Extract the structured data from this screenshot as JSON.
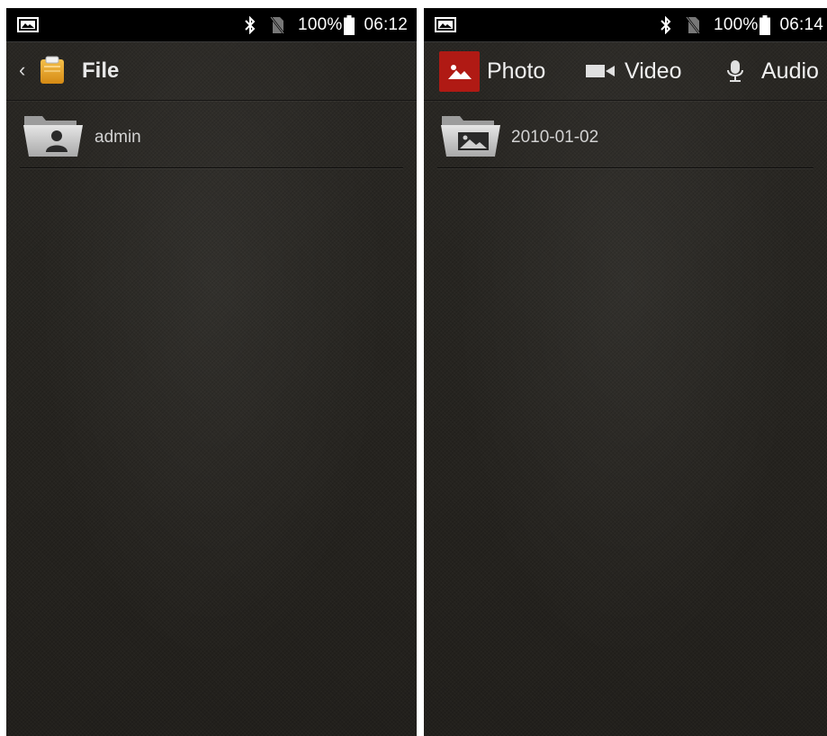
{
  "left_screen": {
    "status_bar": {
      "battery": "100%",
      "time": "06:12",
      "icons": [
        "screenshot-notification-icon",
        "bluetooth-icon",
        "no-sim-icon",
        "battery-icon"
      ]
    },
    "header": {
      "back": "‹",
      "app_icon": "file-manager-icon",
      "title": "File"
    },
    "items": [
      {
        "label": "admin",
        "icon": "user-folder-icon"
      }
    ]
  },
  "right_screen": {
    "status_bar": {
      "battery": "100%",
      "time": "06:14",
      "icons": [
        "screenshot-notification-icon",
        "bluetooth-icon",
        "no-sim-icon",
        "battery-icon"
      ]
    },
    "tabs": [
      {
        "label": "Photo",
        "icon": "photo-icon",
        "selected": true
      },
      {
        "label": "Video",
        "icon": "video-camera-icon",
        "selected": false
      },
      {
        "label": "Audio",
        "icon": "microphone-icon",
        "selected": false
      }
    ],
    "items": [
      {
        "label": "2010-01-02",
        "icon": "image-folder-icon"
      }
    ]
  },
  "colors": {
    "status_bar_bg": "#000000",
    "screen_bg": "#262420",
    "text_primary": "#e8e8e8",
    "active_tab_bg": "#b01a14"
  }
}
